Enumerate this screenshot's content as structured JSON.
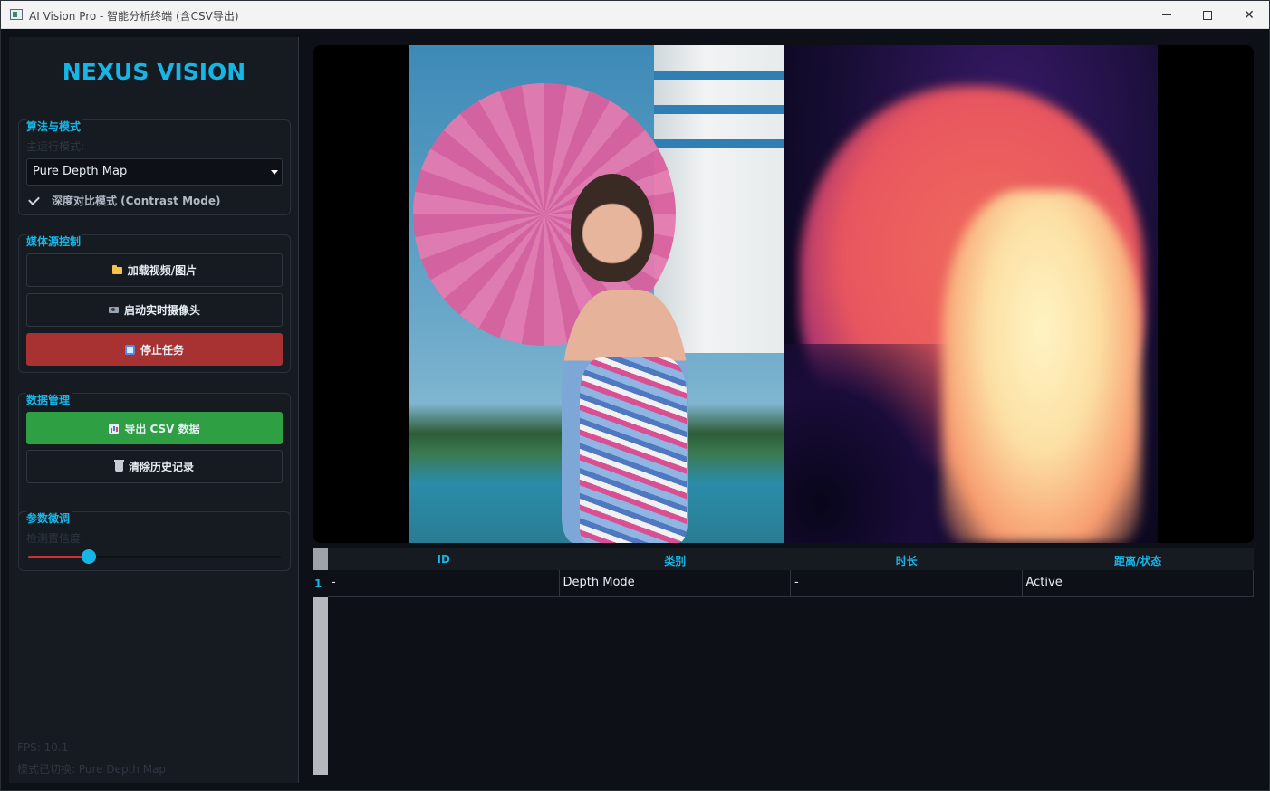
{
  "window": {
    "title": "AI Vision Pro - 智能分析终端 (含CSV导出)"
  },
  "sidebar": {
    "brand": "NEXUS VISION",
    "algorithm": {
      "title": "算法与模式",
      "mode_label": "主运行模式:",
      "mode_value": "Pure Depth Map",
      "contrast_mode": {
        "label": "深度对比模式 (Contrast Mode)",
        "checked": true
      }
    },
    "media": {
      "title": "媒体源控制",
      "load_label": "加载视频/图片",
      "camera_label": "启动实时摄像头",
      "stop_label": "停止任务"
    },
    "data": {
      "title": "数据管理",
      "export_label": "导出 CSV 数据",
      "clear_label": "清除历史记录"
    },
    "params": {
      "title": "参数微调",
      "confidence_label": "检测置信度",
      "confidence_value": 0.24
    },
    "status": {
      "fps": "FPS: 10.1",
      "mode_switched": "模式已切换: Pure Depth Map"
    }
  },
  "table": {
    "columns": [
      "ID",
      "类别",
      "时长",
      "距离/状态"
    ],
    "rows": [
      {
        "index": "1",
        "cells": [
          "-",
          "Depth Mode",
          "-",
          "Active"
        ]
      }
    ]
  },
  "colors": {
    "accent": "#17b5e6",
    "stop": "#a83232",
    "export": "#2ea043",
    "slider_fill": "#d32f2f",
    "background": "#0d1117",
    "panel": "#161b22"
  }
}
